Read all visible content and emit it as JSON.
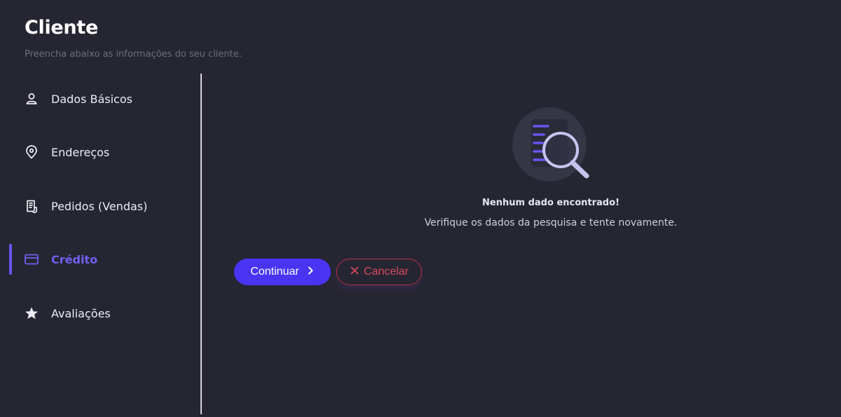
{
  "header": {
    "title": "Cliente",
    "subtitle": "Preencha abaixo as informações do seu cliente."
  },
  "sidebar": {
    "items": [
      {
        "label": "Dados Básicos",
        "icon": "user-icon",
        "active": false
      },
      {
        "label": "Endereços",
        "icon": "location-pin-icon",
        "active": false
      },
      {
        "label": "Pedidos (Vendas)",
        "icon": "receipt-icon",
        "active": false
      },
      {
        "label": "Crédito",
        "icon": "credit-card-icon",
        "active": true
      },
      {
        "label": "Avaliações",
        "icon": "star-icon",
        "active": false
      }
    ]
  },
  "empty_state": {
    "icon": "document-search-icon",
    "title": "Nenhum dado encontrado!",
    "message": "Verifique os dados da pesquisa e tente novamente."
  },
  "actions": {
    "continue_label": "Continuar",
    "continue_icon": "chevron-right-icon",
    "cancel_label": "Cancelar",
    "cancel_icon": "close-icon"
  },
  "colors": {
    "background": "#252631",
    "accent": "#4a34f2",
    "active_text": "#7160f2",
    "danger": "#d94a61"
  }
}
